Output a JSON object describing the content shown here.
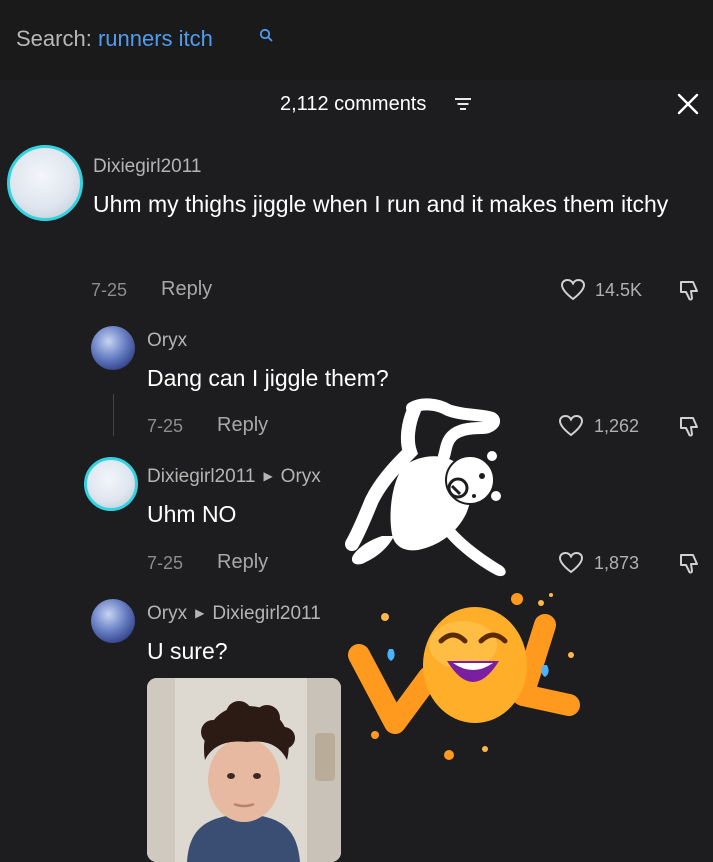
{
  "search": {
    "label": "Search:",
    "term": "runners itch"
  },
  "comments_panel": {
    "count_label": "2,112 comments"
  },
  "comments": [
    {
      "username": "Dixiegirl2011",
      "text": "Uhm my thighs jiggle when I run and it makes them itchy",
      "date": "7-25",
      "reply_label": "Reply",
      "likes": "14.5K"
    },
    {
      "username": "Oryx",
      "text": "Dang can I jiggle them?",
      "date": "7-25",
      "reply_label": "Reply",
      "likes": "1,262"
    },
    {
      "username": "Dixiegirl2011",
      "reply_to": "Oryx",
      "text": "Uhm NO",
      "date": "7-25",
      "reply_label": "Reply",
      "likes": "1,873"
    },
    {
      "username": "Oryx",
      "reply_to": "Dixiegirl2011",
      "text": "U sure?"
    }
  ],
  "colors": {
    "accent": "#4f9cf0",
    "ring": "#32d3e0",
    "sticker_orange": "#ff9a1f"
  }
}
